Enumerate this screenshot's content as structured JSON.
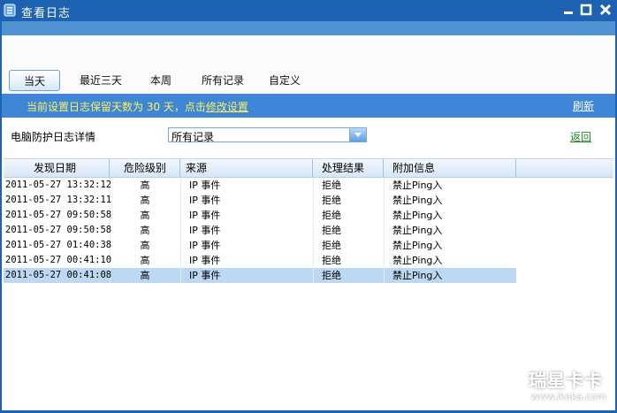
{
  "window": {
    "title": "查看日志"
  },
  "tabs": [
    {
      "label": "当天",
      "active": true
    },
    {
      "label": "最近三天",
      "active": false
    },
    {
      "label": "本周",
      "active": false
    },
    {
      "label": "所有记录",
      "active": false
    },
    {
      "label": "自定义",
      "active": false
    }
  ],
  "info": {
    "text": "当前设置日志保留天数为 30 天，点击",
    "link": "修改设置",
    "refresh": "刷新"
  },
  "filter": {
    "label": "电脑防护日志详情",
    "selected": "所有记录",
    "back": "返回"
  },
  "table": {
    "headers": [
      "发现日期",
      "危险级别",
      "来源",
      "处理结果",
      "附加信息"
    ],
    "rows": [
      {
        "date": "2011-05-27 13:32:12",
        "level": "高",
        "source": "IP 事件",
        "result": "拒绝",
        "extra": "禁止Ping入"
      },
      {
        "date": "2011-05-27 13:32:11",
        "level": "高",
        "source": "IP 事件",
        "result": "拒绝",
        "extra": "禁止Ping入"
      },
      {
        "date": "2011-05-27 09:50:58",
        "level": "高",
        "source": "IP 事件",
        "result": "拒绝",
        "extra": "禁止Ping入"
      },
      {
        "date": "2011-05-27 09:50:58",
        "level": "高",
        "source": "IP 事件",
        "result": "拒绝",
        "extra": "禁止Ping入"
      },
      {
        "date": "2011-05-27 01:40:38",
        "level": "高",
        "source": "IP 事件",
        "result": "拒绝",
        "extra": "禁止Ping入"
      },
      {
        "date": "2011-05-27 00:41:10",
        "level": "高",
        "source": "IP 事件",
        "result": "拒绝",
        "extra": "禁止Ping入"
      },
      {
        "date": "2011-05-27 00:41:08",
        "level": "高",
        "source": "IP 事件",
        "result": "拒绝",
        "extra": "禁止Ping入",
        "selected": true
      }
    ]
  },
  "watermark": {
    "main": "瑞星卡卡",
    "url": "www.ikaka.com"
  },
  "colors": {
    "titlebar": "#1d61b1",
    "infobar": "#3f86d8",
    "link_yellow": "#fff05a",
    "back_green": "#1c8a25",
    "row_selected": "#bcd8f3"
  }
}
